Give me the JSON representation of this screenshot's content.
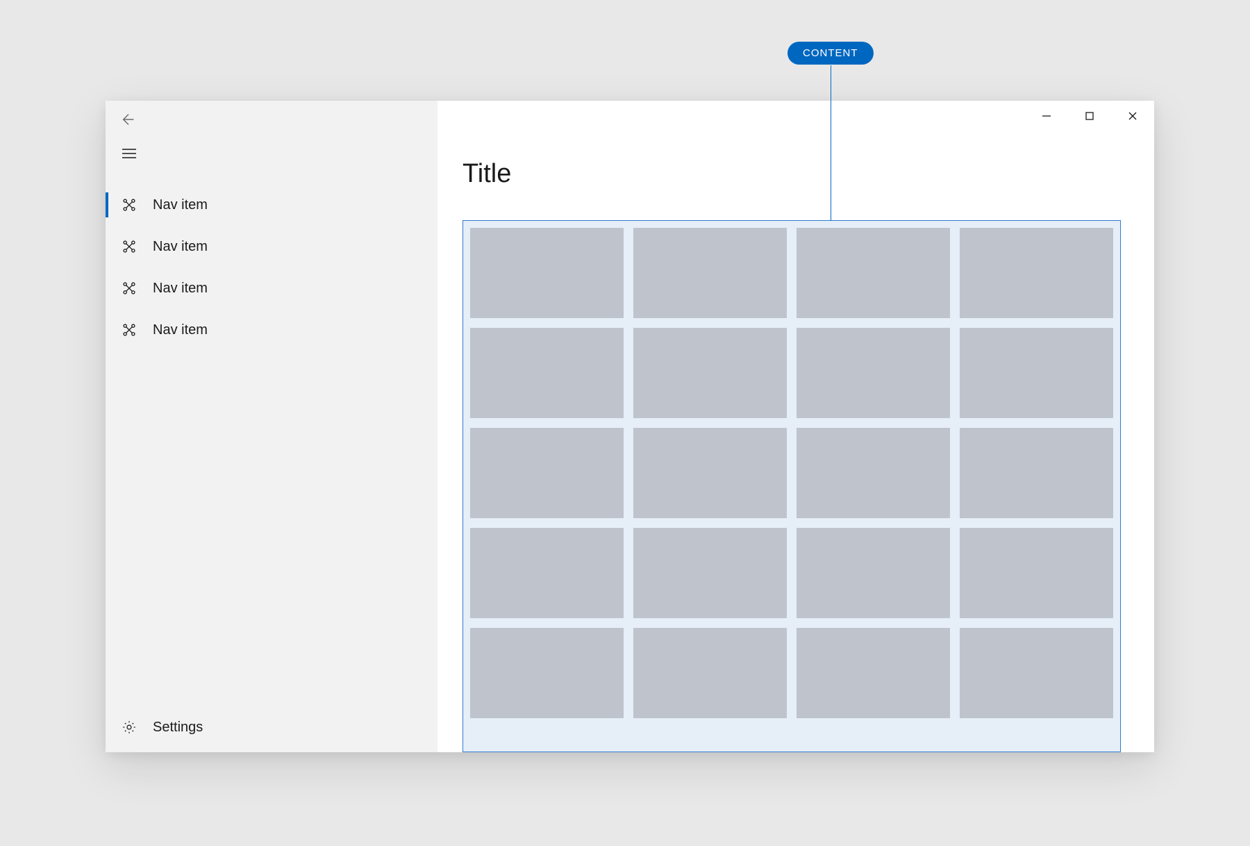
{
  "annotation": {
    "label": "CONTENT"
  },
  "window_controls": {
    "minimize": "Minimize",
    "maximize": "Maximize",
    "close": "Close"
  },
  "sidebar": {
    "items": [
      {
        "label": "Nav item",
        "selected": true
      },
      {
        "label": "Nav item",
        "selected": false
      },
      {
        "label": "Nav item",
        "selected": false
      },
      {
        "label": "Nav item",
        "selected": false
      }
    ],
    "settings_label": "Settings"
  },
  "page": {
    "title": "Title"
  },
  "grid": {
    "columns": 4,
    "rows": 5,
    "tile_count": 20
  },
  "colors": {
    "accent": "#0067c0",
    "outline": "#2f7bd1",
    "grid_bg": "#e6eef8",
    "tile": "#bfc4cc",
    "sidebar_bg": "#f2f2f2"
  }
}
